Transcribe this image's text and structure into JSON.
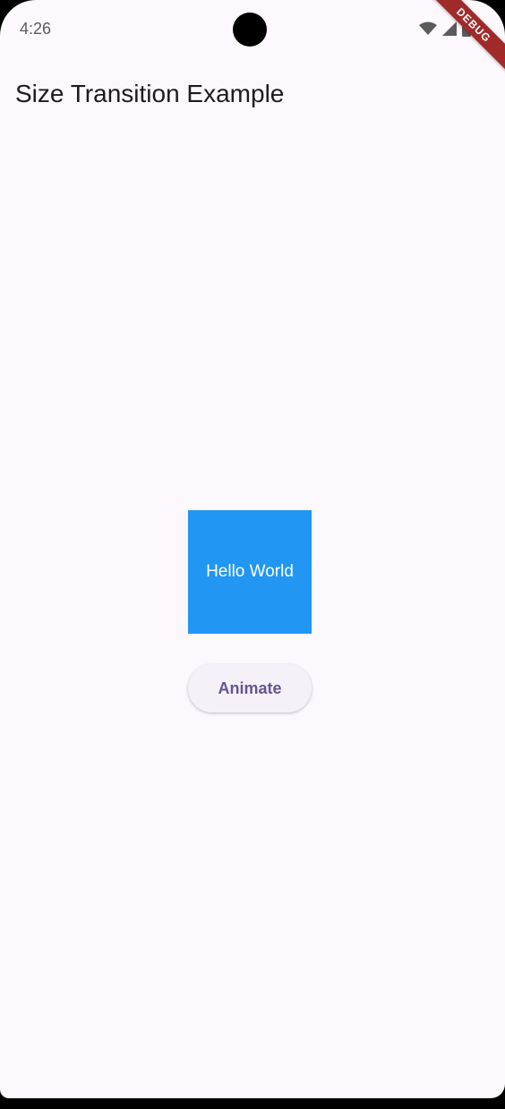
{
  "status_bar": {
    "time": "4:26",
    "icons": [
      "wifi-icon",
      "signal-icon",
      "battery-icon"
    ]
  },
  "debug_banner": {
    "label": "DEBUG"
  },
  "app_bar": {
    "title": "Size Transition Example"
  },
  "content": {
    "box_text": "Hello World",
    "box_color": "#2196f3",
    "button_label": "Animate"
  },
  "colors": {
    "background": "#fdf7fe",
    "button_text": "#65558f",
    "title_text": "#1d1b20"
  }
}
